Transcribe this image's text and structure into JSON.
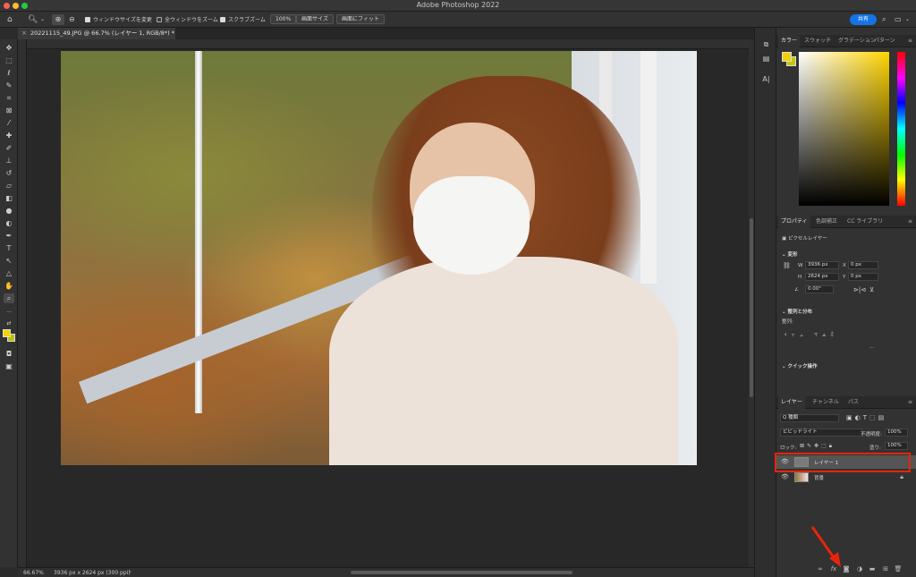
{
  "window": {
    "title": "Adobe Photoshop 2022"
  },
  "options": {
    "resize_windows": "ウィンドウサイズを変更",
    "zoom_all": "全ウィンドウをズーム",
    "scrubby_zoom": "スクラブズーム",
    "zoom_value": "100%",
    "fit_screen": "画面サイズ",
    "fill_screen": "画面にフィット",
    "share": "共有"
  },
  "document": {
    "tab_title": "20221115_49.JPG @ 66.7% (レイヤー 1, RGB/8*) *"
  },
  "status": {
    "zoom": "66.67%",
    "info": "3936 px x 2624 px (300 ppi)"
  },
  "color_panel": {
    "tabs": [
      "カラー",
      "スウォッチ",
      "グラデーション",
      "パターン"
    ],
    "foreground": "#f5d000",
    "background": "#c5c800"
  },
  "properties": {
    "tabs": [
      "プロパティ",
      "色調補正",
      "CC ライブラリ"
    ],
    "layer_type": "ピクセルレイヤー",
    "transform_title": "変形",
    "w_label": "W",
    "w_value": "3936 px",
    "h_label": "H",
    "h_value": "2624 px",
    "x_label": "X",
    "x_value": "0 px",
    "y_label": "Y",
    "y_value": "0 px",
    "angle_value": "0.00°",
    "align_title": "整列と分布",
    "align_label": "整列:",
    "quick_title": "クイック操作"
  },
  "layers": {
    "tabs": [
      "レイヤー",
      "チャンネル",
      "パス"
    ],
    "filter_label": "Q 種類",
    "blend_mode": "ビビッドライト",
    "opacity_label": "不透明度:",
    "opacity_value": "100%",
    "lock_label": "ロック:",
    "fill_label": "塗り:",
    "fill_value": "100%",
    "items": [
      {
        "name": "レイヤー 1",
        "selected": true
      },
      {
        "name": "背景",
        "selected": false
      }
    ]
  },
  "accent": {
    "highlight": "#e8240a",
    "share_button": "#1473e6"
  }
}
